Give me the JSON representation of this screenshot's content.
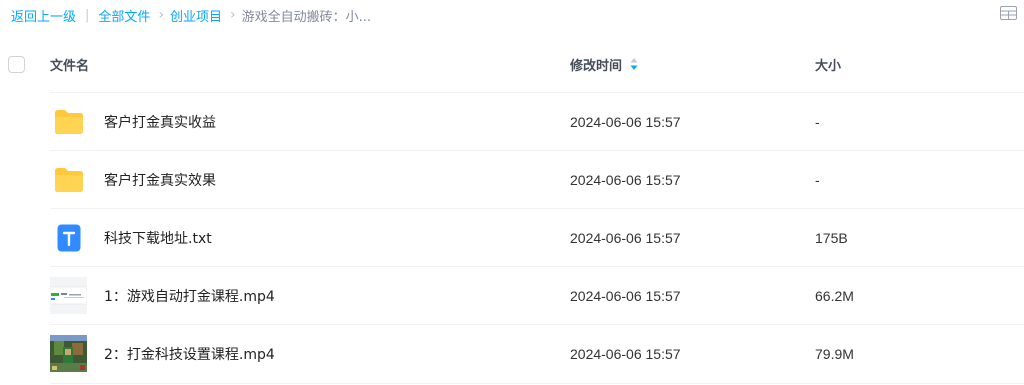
{
  "breadcrumb": {
    "back": "返回上一级",
    "separator": "|",
    "all_files": "全部文件",
    "arrow": "›",
    "project": "创业项目",
    "current": "游戏全自动搬砖：小..."
  },
  "table": {
    "col_name": "文件名",
    "col_time": "修改时间",
    "col_size": "大小",
    "rows": [
      {
        "icon": "folder-icon",
        "name": "客户打金真实收益",
        "time": "2024-06-06 15:57",
        "size": "-"
      },
      {
        "icon": "folder-icon",
        "name": "客户打金真实效果",
        "time": "2024-06-06 15:57",
        "size": "-"
      },
      {
        "icon": "text-file-icon",
        "name": "科技下载地址.txt",
        "time": "2024-06-06 15:57",
        "size": "175B"
      },
      {
        "icon": "video-thumbnail-icon",
        "name": "1：游戏自动打金课程.mp4",
        "time": "2024-06-06 15:57",
        "size": "66.2M"
      },
      {
        "icon": "video-thumbnail-icon",
        "name": "2：打金科技设置课程.mp4",
        "time": "2024-06-06 15:57",
        "size": "79.9M"
      }
    ]
  },
  "colors": {
    "link": "#06a7ff",
    "folder": "#ffc83d",
    "txt_icon": "#2f8bff"
  }
}
